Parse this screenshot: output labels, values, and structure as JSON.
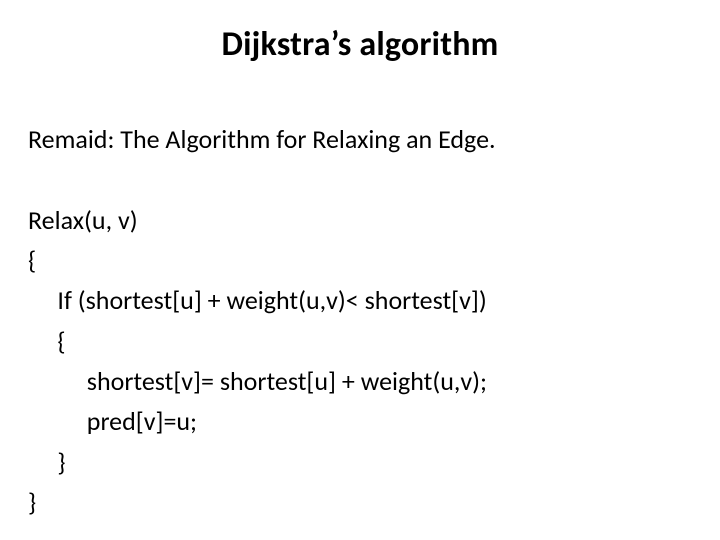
{
  "slide": {
    "title": "Dijkstra’s algorithm",
    "remark": "Remaid: The Algorithm for Relaxing an Edge.",
    "code": {
      "l1": "Relax(u, v)",
      "l2": "{",
      "l3": "     If (shortest[u] + weight(u,v)< shortest[v])",
      "l4": "     {",
      "l5": "          shortest[v]= shortest[u] + weight(u,v);",
      "l6": "          pred[v]=u;",
      "l7": "     }",
      "l8": "}"
    }
  }
}
